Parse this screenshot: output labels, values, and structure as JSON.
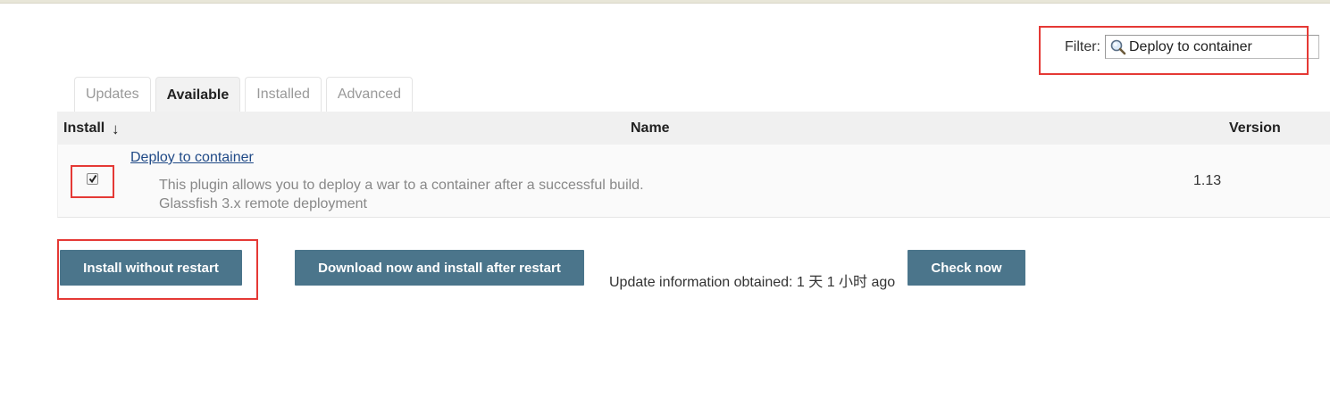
{
  "filter": {
    "label": "Filter:",
    "value": "Deploy to container"
  },
  "tabs": [
    {
      "label": "Updates",
      "active": false
    },
    {
      "label": "Available",
      "active": true
    },
    {
      "label": "Installed",
      "active": false
    },
    {
      "label": "Advanced",
      "active": false
    }
  ],
  "table": {
    "headers": {
      "install": "Install",
      "sort_arrow": "↓",
      "name": "Name",
      "version": "Version"
    },
    "rows": [
      {
        "checked": true,
        "name": "Deploy to container",
        "description_line1": "This plugin allows you to deploy a war to a container after a successful build.",
        "description_line2": "Glassfish 3.x remote deployment",
        "version": "1.13"
      }
    ]
  },
  "actions": {
    "install_without_restart": "Install without restart",
    "download_and_install": "Download now and install after restart",
    "update_info": "Update information obtained: 1 天 1 小时 ago",
    "check_now": "Check now"
  },
  "colors": {
    "button_bg": "#4b758b",
    "link": "#204a87",
    "highlight": "#e53935"
  },
  "icons": {
    "filter_icon": "magnifier-icon",
    "checkbox_mark": "checkmark-icon"
  }
}
